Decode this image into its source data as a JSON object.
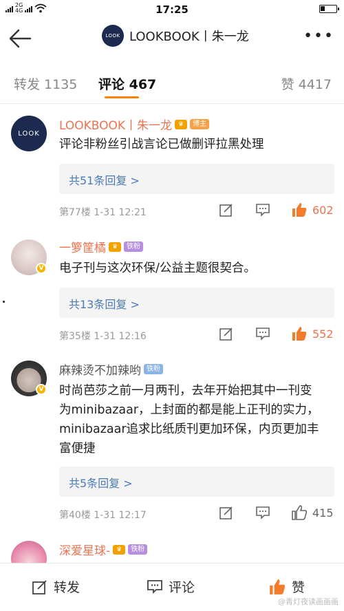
{
  "status_bar": {
    "time": "17:25",
    "network_top": "2G",
    "network_bottom": "4G"
  },
  "nav": {
    "title": "LOOKBOOK丨朱一龙",
    "logo_text": "LOOK",
    "more": "•••"
  },
  "tabs": [
    {
      "label": "转发 1135",
      "active": false
    },
    {
      "label": "评论 467",
      "active": true
    },
    {
      "label": "赞 4417",
      "active": false
    }
  ],
  "comments": [
    {
      "user": "LOOKBOOK丨朱一龙",
      "avatar_text": "LOOK",
      "tag": "博主",
      "text": "评论非粉丝引战言论已做删评拉黑处理",
      "replies": "共51条回复 >",
      "meta": "第77楼  1-31 12:21",
      "likes": "602"
    },
    {
      "user": "一箩筐橘",
      "tag": "铁粉",
      "text": "电子刊与这次环保/公益主题很契合。",
      "replies": "共13条回复 >",
      "meta": "第35楼  1-31 12:16",
      "likes": "552"
    },
    {
      "user": "麻辣烫不加辣哟",
      "tag": "铁粉",
      "text": "时尚芭莎之前一月两刊，去年开始把其中一刊变为minibazaar，上封面的都是能上正刊的实力，minibazaar追求比纸质刊更加环保，内页更加丰富便捷",
      "replies": "共5条回复 >",
      "meta": "第40楼  1-31 12:17",
      "likes": "415"
    },
    {
      "user": "深爱星球-",
      "tag": "铁粉"
    }
  ],
  "bottom_bar": {
    "repost": "转发",
    "comment": "评论",
    "like": "赞"
  },
  "watermark": "@青灯夜读画画画",
  "colors": {
    "accent": "#ff8200",
    "username": "#eb7350",
    "reply_link": "#4a7ab5",
    "navy_logo": "#1b2a4e"
  }
}
